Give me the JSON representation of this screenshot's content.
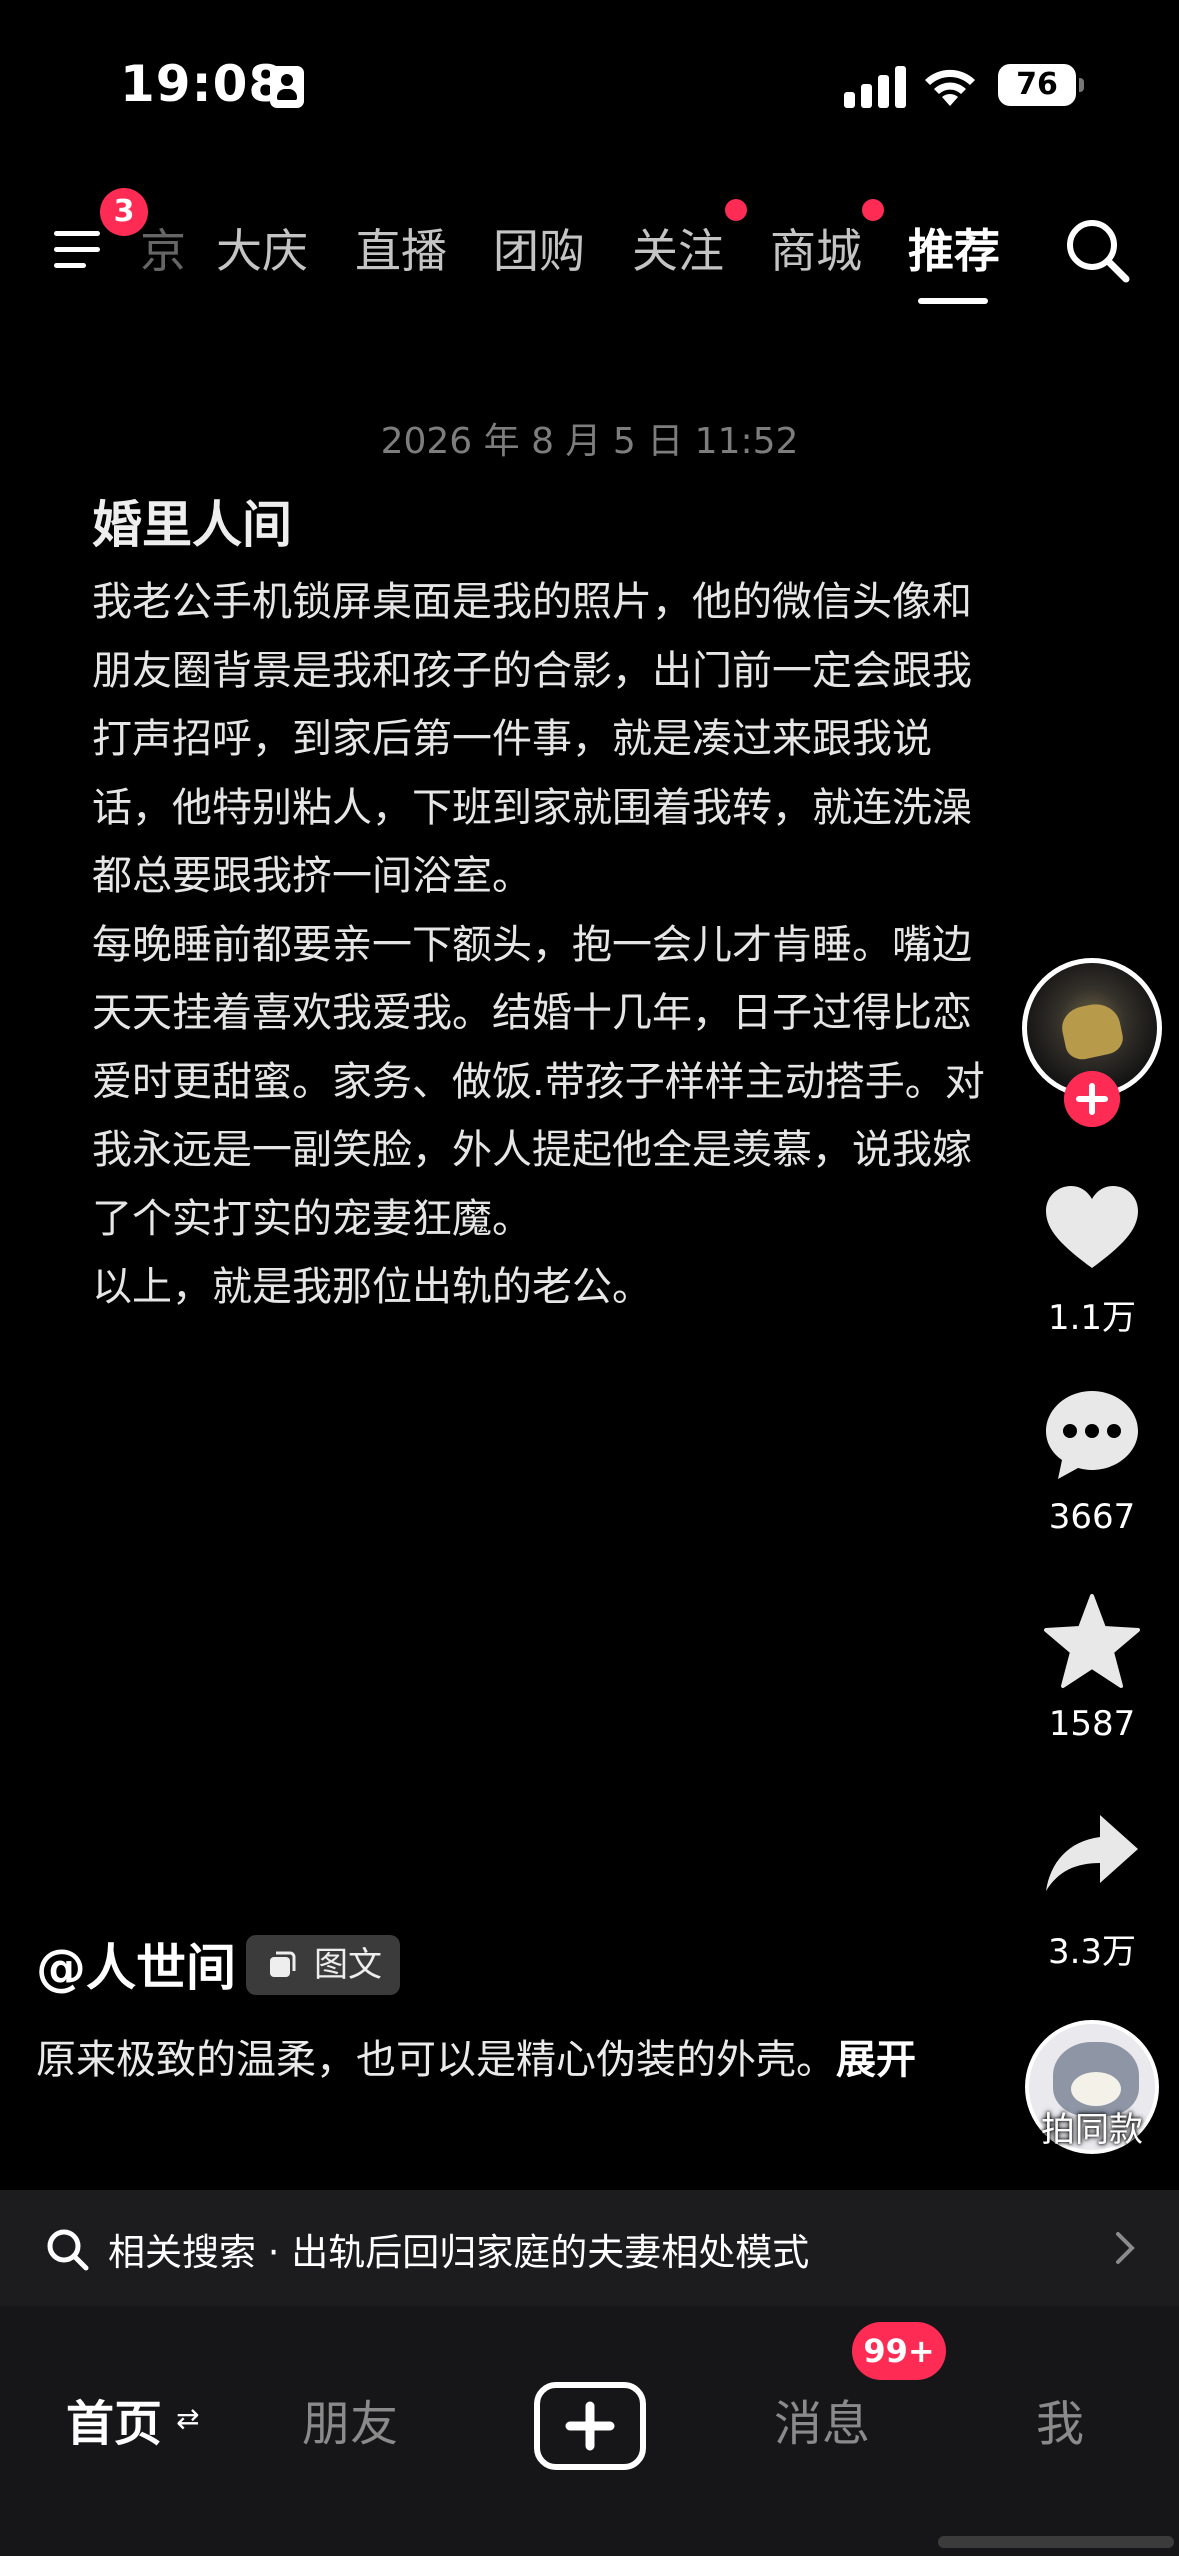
{
  "status_bar": {
    "time": "19:08",
    "battery": "76"
  },
  "top_nav": {
    "menu_badge": "3",
    "tabs": [
      {
        "label": "京"
      },
      {
        "label": "大庆"
      },
      {
        "label": "直播"
      },
      {
        "label": "团购"
      },
      {
        "label": "关注"
      },
      {
        "label": "商城"
      },
      {
        "label": "推荐"
      }
    ]
  },
  "post": {
    "date": "2026 年 8 月 5 日 11:52",
    "title": "婚里人间",
    "lines": [
      "我老公手机锁屏桌面是我的照片，他的微信头像和",
      "朋友圈背景是我和孩子的合影，出门前一定会跟我",
      "打声招呼，到家后第一件事，就是凑过来跟我说",
      "话，他特别粘人，下班到家就围着我转，就连洗澡",
      "都总要跟我挤一间浴室。",
      "每晚睡前都要亲一下额头，抱一会儿才肯睡。嘴边",
      "天天挂着喜欢我爱我。结婚十几年，日子过得比恋",
      "爱时更甜蜜。家务、做饭.带孩子样样主动搭手。对",
      "我永远是一副笑脸，外人提起他全是羡慕，说我嫁",
      "了个实打实的宠妻狂魔。",
      "以上，就是我那位出轨的老公。"
    ]
  },
  "rail": {
    "likes": "1.1万",
    "comments": "3667",
    "favorites": "1587",
    "shares": "3.3万",
    "remake_label": "拍同款"
  },
  "author": {
    "handle": "@人世间",
    "post_type": "图文"
  },
  "caption": {
    "text": "原来极致的温柔，也可以是精心伪装的外壳。",
    "more": "展开"
  },
  "related_search": {
    "label": "相关搜索 · 出轨后回归家庭的夫妻相处模式"
  },
  "bottom_tabs": {
    "home": "首页",
    "friends": "朋友",
    "messages": "消息",
    "messages_badge": "99+",
    "me": "我"
  },
  "colors": {
    "accent": "#fe2c55",
    "background": "#000000",
    "panel": "#1c1c1e"
  }
}
